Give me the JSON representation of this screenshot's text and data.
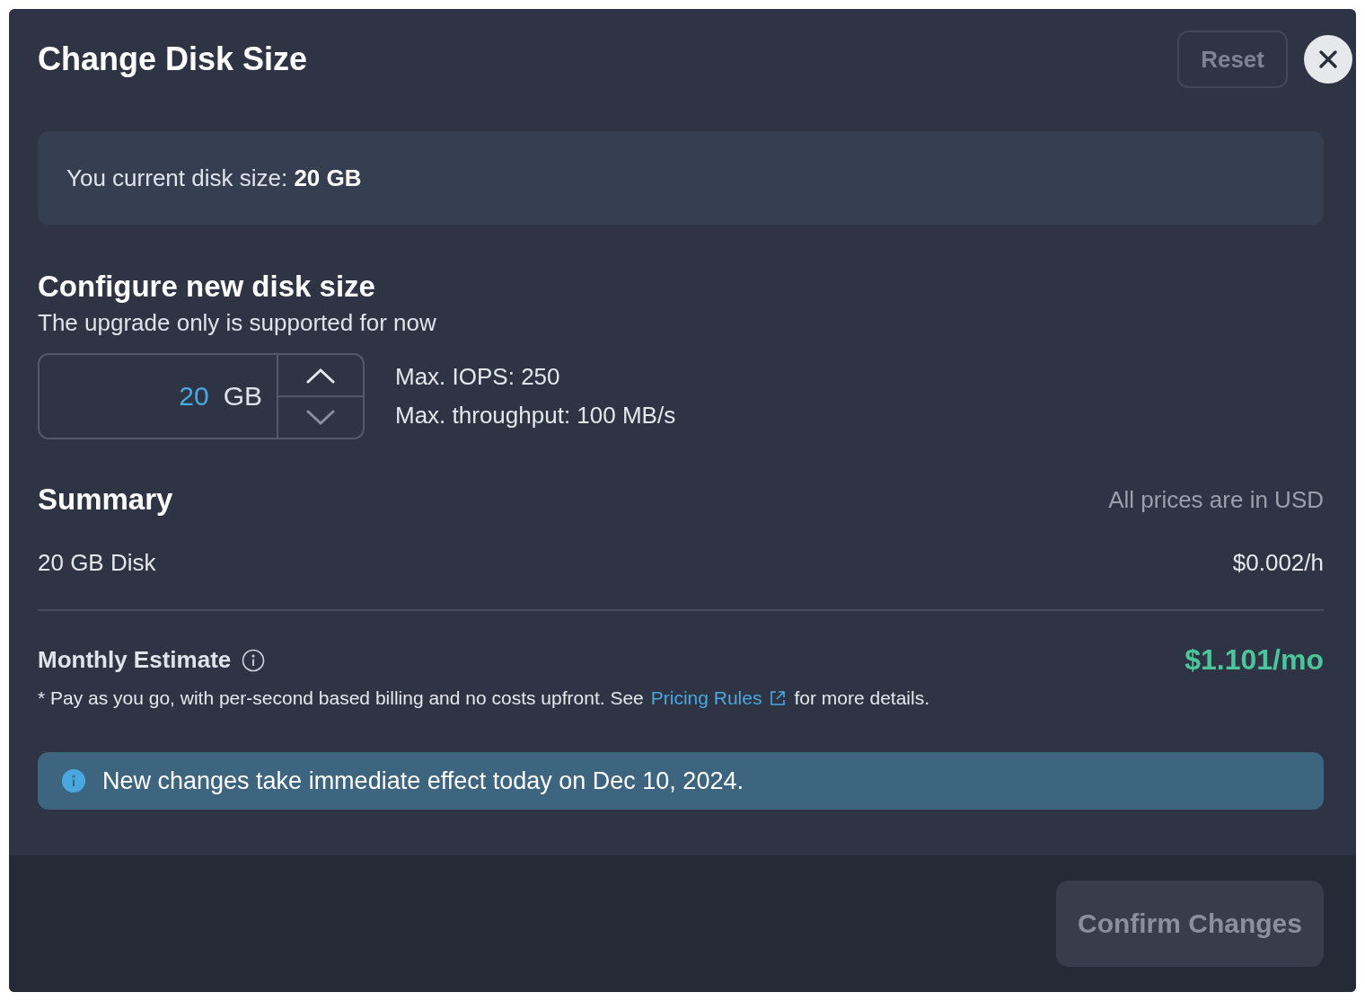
{
  "dialog": {
    "title": "Change Disk Size",
    "reset_button": {
      "label": "Reset",
      "disabled": true
    }
  },
  "current_disk": {
    "text": "You current disk size: **20 GB**"
  },
  "configure": {
    "title": "Configure new disk size",
    "subtitle": "The upgrade only is supported for now",
    "stepper": {
      "value": "20",
      "unit": "GB",
      "up_disabled": false,
      "down_disabled": true
    },
    "specs": [
      "Max. IOPS: 250",
      "Max. throughput: 100 MB/s"
    ]
  },
  "summary": {
    "title": "Summary",
    "currency_note": "All prices are in USD",
    "items": [
      {
        "label": "20 GB Disk",
        "price": "$0.002/h"
      }
    ],
    "monthly_label": "Monthly Estimate",
    "monthly_price": "$1.101/mo",
    "note_before": "* Pay as you go, with per-second based billing and no costs upfront. See",
    "note_link": "Pricing Rules",
    "note_after": "for more details."
  },
  "alert": {
    "text": "New changes take immediate effect today on Dec 10, 2024."
  },
  "footer": {
    "confirm_button": {
      "label": "Confirm Changes",
      "disabled": true
    }
  }
}
